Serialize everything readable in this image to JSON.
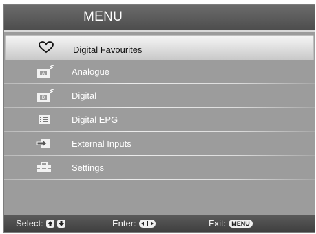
{
  "header": {
    "title": "MENU"
  },
  "menu": {
    "items": [
      {
        "label": "Digital Favourites",
        "icon": "heart-icon",
        "selected": true
      },
      {
        "label": "Analogue",
        "icon": "analogue-tv-icon"
      },
      {
        "label": "Digital",
        "icon": "digital-tv-icon"
      },
      {
        "label": "Digital EPG",
        "icon": "epg-list-icon"
      },
      {
        "label": "External Inputs",
        "icon": "input-arrow-icon"
      },
      {
        "label": "Settings",
        "icon": "toolbox-icon"
      }
    ]
  },
  "footer": {
    "select_label": "Select:",
    "enter_label": "Enter:",
    "exit_label": "Exit:",
    "exit_key": "MENU"
  }
}
